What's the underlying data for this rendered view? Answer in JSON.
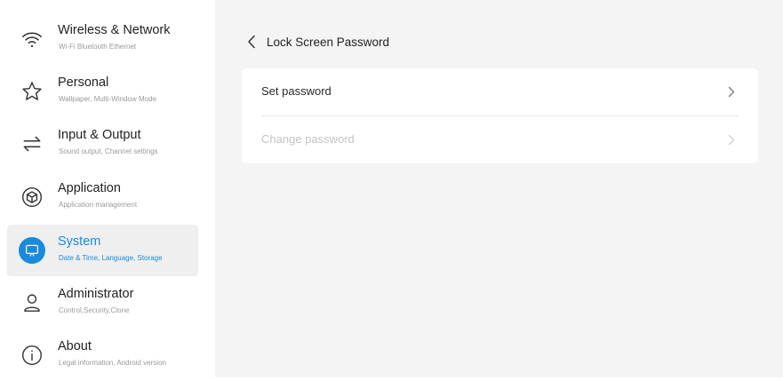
{
  "sidebar": {
    "items": [
      {
        "title": "Wireless & Network",
        "subtitle": "Wi-Fi Bluetooth Ethernet",
        "icon": "wifi-icon",
        "active": false
      },
      {
        "title": "Personal",
        "subtitle": "Wallpaper, Multi-Window Mode",
        "icon": "star-icon",
        "active": false
      },
      {
        "title": "Input & Output",
        "subtitle": "Sound output, Channel settings",
        "icon": "swap-arrows-icon",
        "active": false
      },
      {
        "title": "Application",
        "subtitle": "Application management",
        "icon": "cube-icon",
        "active": false
      },
      {
        "title": "System",
        "subtitle": "Date & Time, Language, Storage",
        "icon": "monitor-icon",
        "active": true
      },
      {
        "title": "Administrator",
        "subtitle": "Control,Security,Clone",
        "icon": "user-icon",
        "active": false
      },
      {
        "title": "About",
        "subtitle": "Legal information, Android version",
        "icon": "info-icon",
        "active": false
      }
    ]
  },
  "main": {
    "page_title": "Lock Screen Password",
    "rows": [
      {
        "label": "Set password",
        "enabled": true
      },
      {
        "label": "Change password",
        "enabled": false
      }
    ]
  },
  "colors": {
    "accent": "#1a8bdc",
    "main_background": "#f4f4f4",
    "active_item_background": "#efefef",
    "disabled_text": "#c4c4c4"
  }
}
